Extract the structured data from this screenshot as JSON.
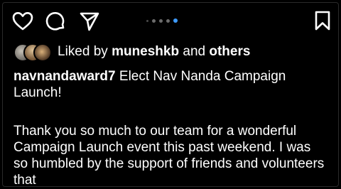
{
  "icons": {
    "like": "heart-icon",
    "comment": "comment-icon",
    "share": "share-icon",
    "save": "bookmark-icon"
  },
  "carousel": {
    "total": 5,
    "active_index": 4
  },
  "likes": {
    "prefix": "Liked by",
    "user": "muneshkb",
    "conjunction": "and",
    "others": "others"
  },
  "caption": {
    "username": "navnandaward7",
    "text": "Elect Nav Nanda Campaign Launch!"
  },
  "body": {
    "paragraph": "Thank you so much to our team for a wonderful Campaign Launch event this past weekend. I was so humbled by the support of friends and volunteers that"
  },
  "colors": {
    "background": "#000000",
    "text": "#ffffff",
    "active_dot": "#3e9bff"
  }
}
